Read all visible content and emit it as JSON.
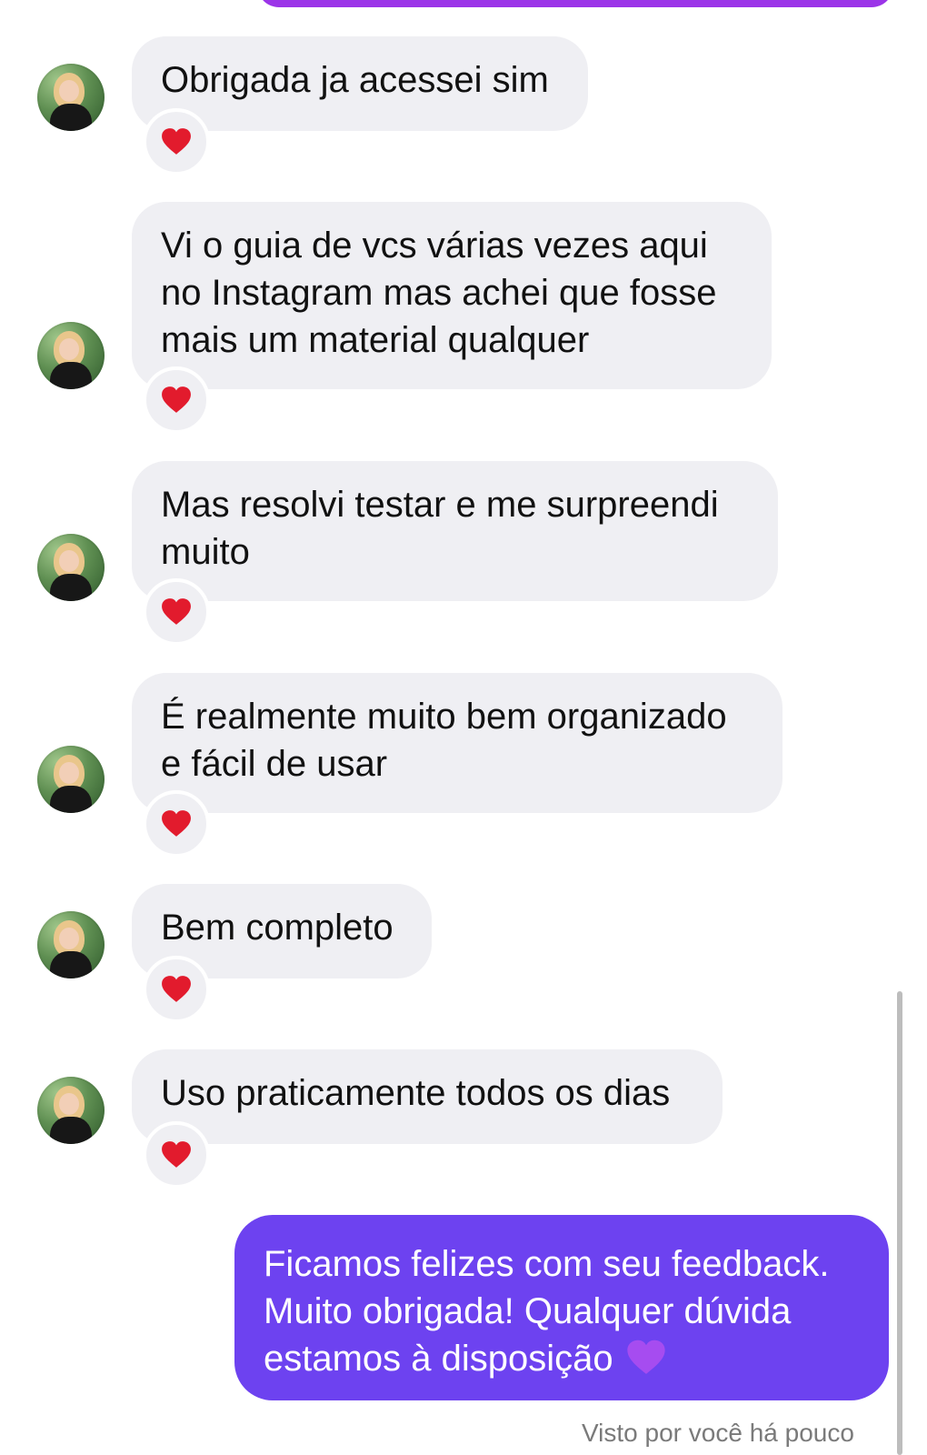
{
  "conversation": {
    "incoming_messages": [
      {
        "text": "Obrigada ja acessei sim",
        "reaction": "heart-reaction"
      },
      {
        "text": "Vi o guia de vcs várias vezes aqui no Instagram mas achei que fosse mais um material qualquer",
        "reaction": "heart-reaction"
      },
      {
        "text": "Mas resolvi testar e me surpreendi muito",
        "reaction": "heart-reaction"
      },
      {
        "text": "É realmente muito bem organizado e fácil de usar",
        "reaction": "heart-reaction"
      },
      {
        "text": "Bem completo",
        "reaction": "heart-reaction"
      },
      {
        "text": "Uso praticamente todos os dias",
        "reaction": "heart-reaction"
      }
    ],
    "outgoing_message": {
      "text": "Ficamos felizes com seu feedback. Muito obrigada! Qualquer dúvida estamos à disposição"
    },
    "seen_label": "Visto por você há pouco"
  },
  "colors": {
    "incoming_bubble": "#efeff3",
    "outgoing_bubble": "#6d42f0",
    "top_bubble": "#9b34e8",
    "heart": "#e21b2d",
    "purple_heart": "#a64cf0"
  }
}
